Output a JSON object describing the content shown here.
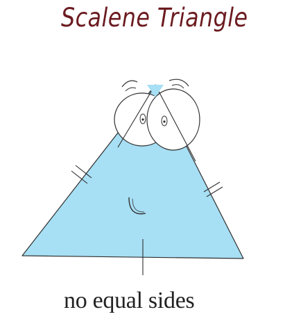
{
  "title": "Scalene Triangle",
  "caption": "no equal sides",
  "colors": {
    "triangle_fill": "#a7dff4",
    "triangle_stroke": "#2f2f2f",
    "title_color": "#6b1b20"
  }
}
